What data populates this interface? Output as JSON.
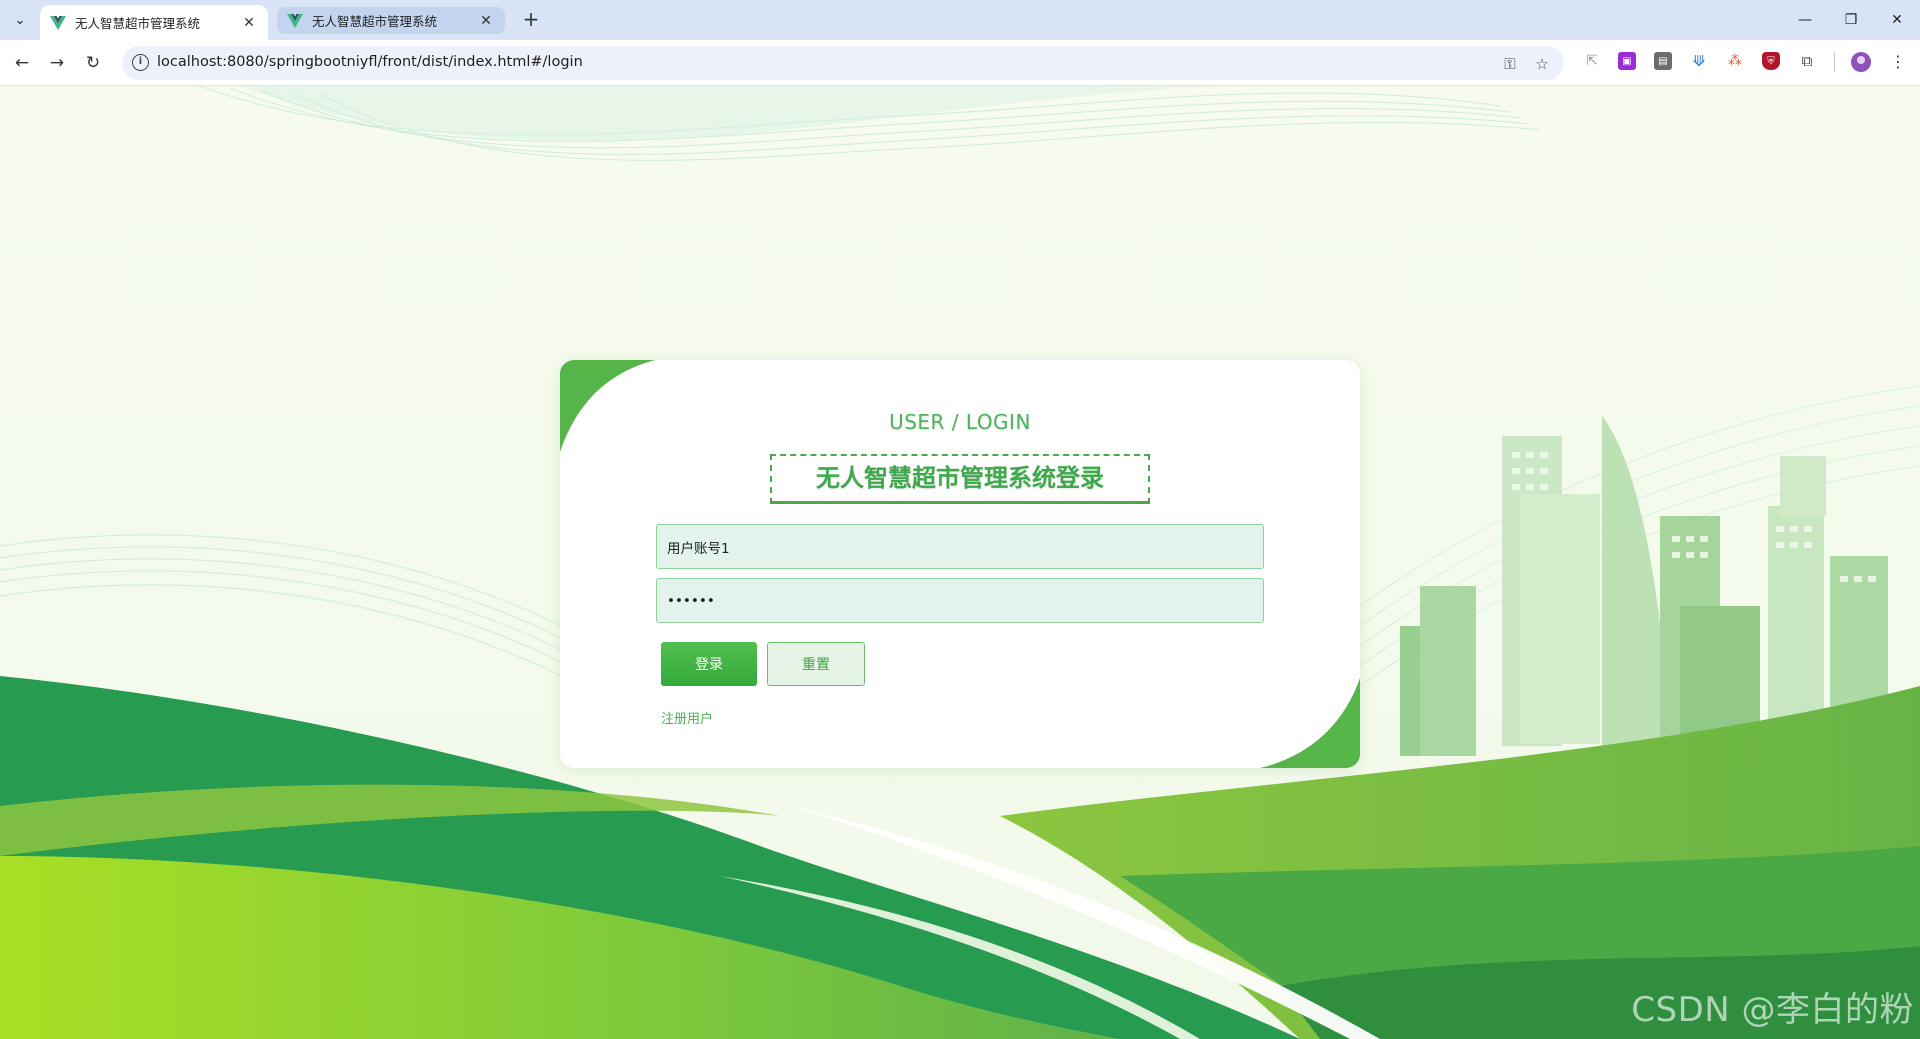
{
  "browser": {
    "tabs": [
      {
        "title": "无人智慧超市管理系统",
        "active": true
      },
      {
        "title": "无人智慧超市管理系统",
        "active": false
      }
    ],
    "url": "localhost:8080/springbootniyfl/front/dist/index.html#/login"
  },
  "login": {
    "subtitle": "USER / LOGIN",
    "title": "无人智慧超市管理系统登录",
    "username_value": "用户账号1",
    "password_value": "••••••",
    "login_button": "登录",
    "reset_button": "重置",
    "register_link": "注册用户"
  },
  "watermark": "CSDN @李白的粉",
  "colors": {
    "accent": "#4db35a",
    "dark_green": "#279b50",
    "light_green": "#8fd19a"
  }
}
